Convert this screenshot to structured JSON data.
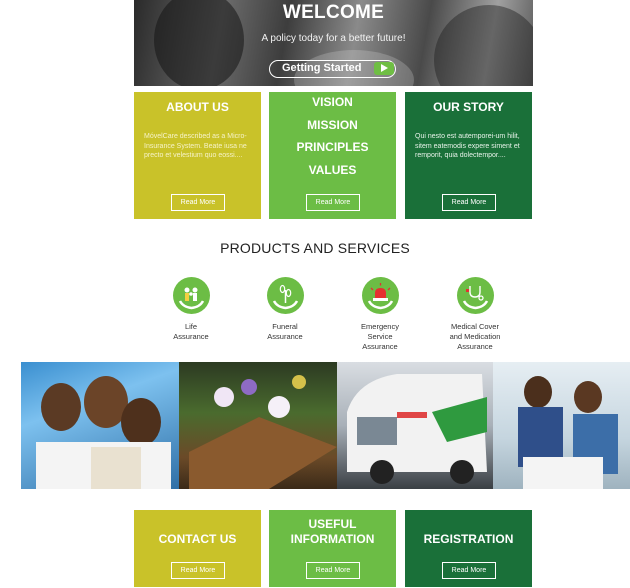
{
  "hero": {
    "title": "WELCOME",
    "subtitle": "A policy today for a better future!",
    "cta_label": "Getting Started"
  },
  "tiles_top": [
    {
      "title": "ABOUT US",
      "body": "MóvelCare described as a Micro-Insurance System. Beate iusa ne precto et velestium quo eossi....",
      "button": "Read More",
      "color": "#c9c229"
    },
    {
      "lines": [
        "VISION",
        "MISSION",
        "PRINCIPLES",
        "VALUES"
      ],
      "button": "Read More",
      "color": "#6cbd45"
    },
    {
      "title": "OUR STORY",
      "body": "Qui nesto est autemporei-um hilit, sitem eatemodis expere siment et remporit, quia dolectempor....",
      "button": "Read More",
      "color": "#1a7039"
    }
  ],
  "products": {
    "heading": "PRODUCTS AND SERVICES",
    "items": [
      {
        "label_lines": [
          "Life",
          "Assurance"
        ],
        "icon": "family-hands-icon"
      },
      {
        "label_lines": [
          "Funeral",
          "Assurance"
        ],
        "icon": "flower-hands-icon"
      },
      {
        "label_lines": [
          "Emergency",
          "Service",
          "Assurance"
        ],
        "icon": "siren-hands-icon"
      },
      {
        "label_lines": [
          "Medical Cover",
          "and Medication",
          "Assurance"
        ],
        "icon": "stethoscope-hands-icon"
      }
    ]
  },
  "tiles_bottom": [
    {
      "title_lines": [
        "CONTACT US"
      ],
      "button": "Read More",
      "color": "#c9c229"
    },
    {
      "title_lines": [
        "USEFUL",
        "INFORMATION"
      ],
      "button": "Read More",
      "color": "#6cbd45"
    },
    {
      "title_lines": [
        "REGISTRATION"
      ],
      "button": "Read More",
      "color": "#1a7039"
    }
  ]
}
